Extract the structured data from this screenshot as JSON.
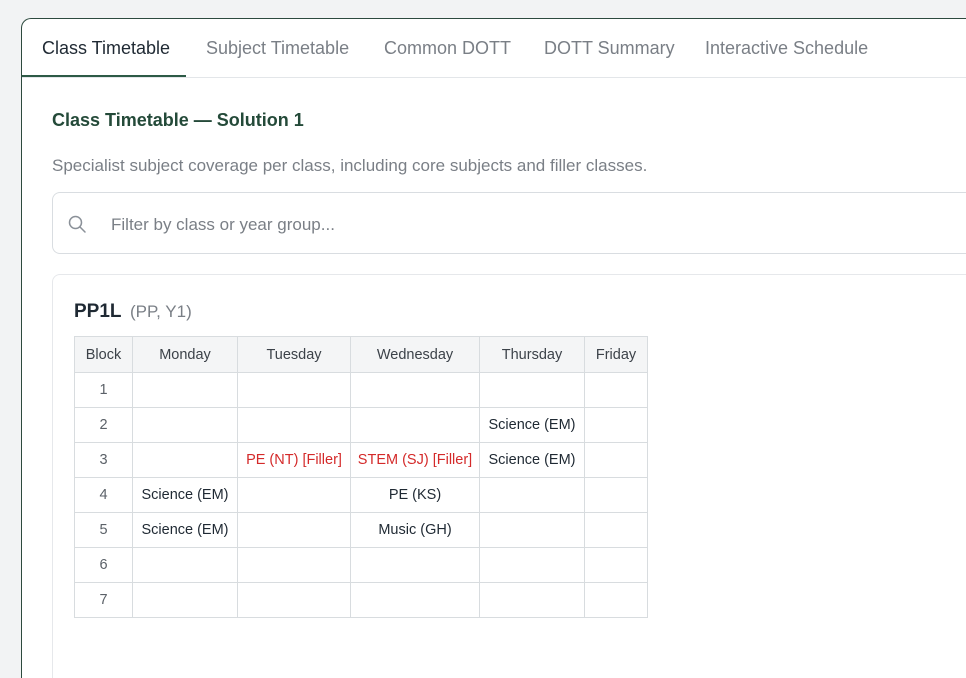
{
  "tabs": [
    {
      "label": "Class Timetable",
      "active": true
    },
    {
      "label": "Subject Timetable",
      "active": false
    },
    {
      "label": "Common DOTT",
      "active": false
    },
    {
      "label": "DOTT Summary",
      "active": false
    },
    {
      "label": "Interactive Schedule",
      "active": false
    }
  ],
  "section": {
    "title": "Class Timetable — Solution 1",
    "description": "Specialist subject coverage per class, including core subjects and filler classes."
  },
  "search": {
    "placeholder": "Filter by class or year group...",
    "value": "",
    "icon": "search-icon"
  },
  "class_card": {
    "name": "PP1L",
    "meta": "(PP, Y1)",
    "columns": [
      "Block",
      "Monday",
      "Tuesday",
      "Wednesday",
      "Thursday",
      "Friday"
    ],
    "rows": [
      {
        "block": "1",
        "cells": [
          "",
          "",
          "",
          "",
          ""
        ]
      },
      {
        "block": "2",
        "cells": [
          "",
          "",
          "",
          "Science (EM)",
          ""
        ]
      },
      {
        "block": "3",
        "cells": [
          "",
          "PE (NT) [Filler]",
          "STEM (SJ) [Filler]",
          "Science (EM)",
          ""
        ]
      },
      {
        "block": "4",
        "cells": [
          "Science (EM)",
          "",
          "PE (KS)",
          "",
          ""
        ]
      },
      {
        "block": "5",
        "cells": [
          "Science (EM)",
          "",
          "Music (GH)",
          "",
          ""
        ]
      },
      {
        "block": "6",
        "cells": [
          "",
          "",
          "",
          "",
          ""
        ]
      },
      {
        "block": "7",
        "cells": [
          "",
          "",
          "",
          "",
          ""
        ]
      }
    ]
  },
  "colors": {
    "accent": "#2d5a46",
    "filler_text": "#d42a2a",
    "muted_text": "#7a7f86"
  }
}
